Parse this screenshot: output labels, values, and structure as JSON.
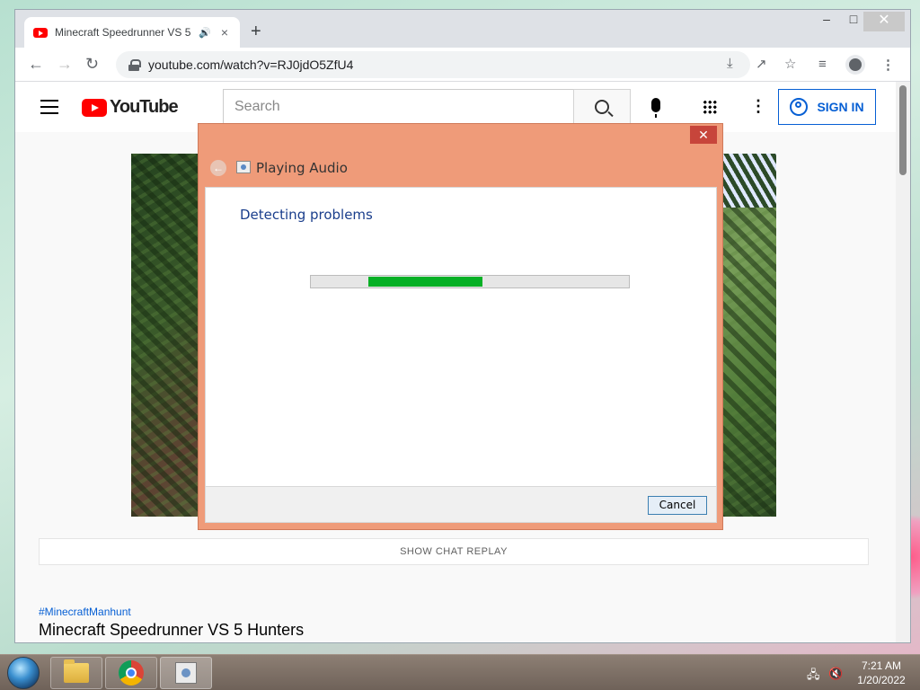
{
  "browser": {
    "tab_title": "Minecraft Speedrunner VS 5",
    "tab_audio_icon": "speaker-icon",
    "tab_close": "×",
    "new_tab": "+",
    "url": "youtube.com/watch?v=RJ0jdO5ZfU4",
    "window_controls": {
      "minimize": "–",
      "maximize": "□",
      "close": "✕"
    }
  },
  "youtube": {
    "logo_text": "YouTube",
    "search_placeholder": "Search",
    "signin_label": "SIGN IN",
    "chat_replay_label": "SHOW CHAT REPLAY",
    "hashtag": "#MinecraftManhunt",
    "video_title": "Minecraft Speedrunner VS 5 Hunters"
  },
  "dialog": {
    "heading": "Playing Audio",
    "status": "Detecting problems",
    "progress_fraction": 0.36,
    "progress_offset_fraction": 0.18,
    "cancel_label": "Cancel",
    "close_glyph": "✕",
    "back_glyph": "←"
  },
  "taskbar": {
    "time": "7:21 AM",
    "date": "1/20/2022",
    "apps": [
      "file-explorer-icon",
      "chrome-icon",
      "troubleshooter-icon"
    ]
  },
  "colors": {
    "dialog_frame": "#ef9b79",
    "progress_green": "#06b025",
    "youtube_red": "#ff0000",
    "signin_blue": "#065fd4"
  }
}
